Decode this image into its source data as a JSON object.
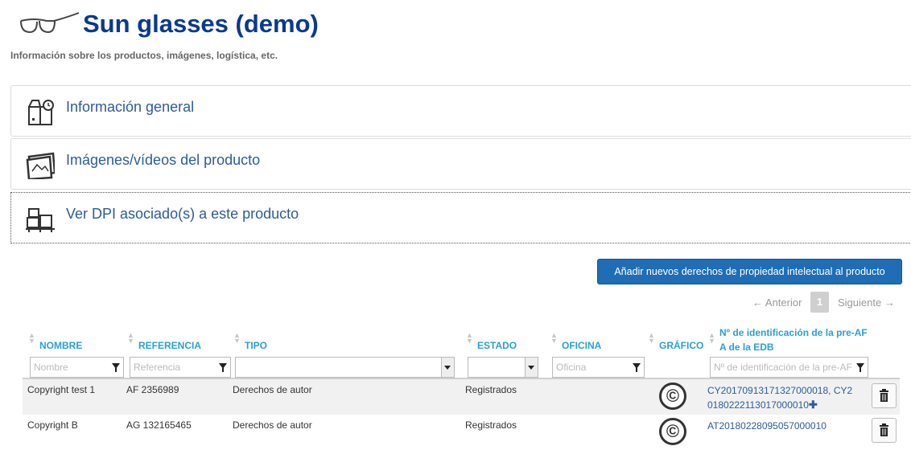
{
  "header": {
    "title": "Sun glasses (demo)",
    "subtitle": "Información sobre los productos, imágenes, logística, etc."
  },
  "sections": [
    {
      "label": "Información general",
      "icon": "box-clock-icon"
    },
    {
      "label": "Imágenes/vídeos del producto",
      "icon": "photos-icon"
    },
    {
      "label": "Ver DPI asociado(s) a este producto",
      "icon": "pallet-boxes-icon"
    }
  ],
  "actions": {
    "add_ipr_label": "Añadir nuevos derechos de propiedad intelectual al producto"
  },
  "pagination": {
    "prev_label": "← Anterior",
    "current_page": "1",
    "next_label": "Siguiente →"
  },
  "table": {
    "columns": {
      "nombre": "NOMBRE",
      "referencia": "REFERENCIA",
      "tipo": "TIPO",
      "estado": "ESTADO",
      "oficina": "OFICINA",
      "grafico": "GRÁFICO",
      "preaf_line1": "Nº de identificación de la pre-AF",
      "preaf_line2": "A de la EDB"
    },
    "filters": {
      "nombre_placeholder": "Nombre",
      "referencia_placeholder": "Referencia",
      "tipo_value": "",
      "estado_value": "",
      "oficina_placeholder": "Oficina",
      "preaf_placeholder": "Nº de identificación de la pre-AF"
    },
    "rows": [
      {
        "nombre": "Copyright test 1",
        "referencia": "AF 2356989",
        "tipo": "Derechos de autor",
        "estado": "Registrados",
        "oficina": "",
        "grafico": "©",
        "preaf_line1": "CY20170913171327000018, CY2",
        "preaf_line2": "0180222113017000010",
        "more": "✚"
      },
      {
        "nombre": "Copyright B",
        "referencia": "AG 132165465",
        "tipo": "Derechos de autor",
        "estado": "Registrados",
        "oficina": "",
        "grafico": "©",
        "preaf_line1": "AT20180228095057000010",
        "preaf_line2": "",
        "more": ""
      }
    ]
  },
  "colors": {
    "title": "#0a3a8e",
    "section_label": "#2d5b9c",
    "column_header": "#2a9fd6",
    "primary_button": "#1e6db5"
  }
}
